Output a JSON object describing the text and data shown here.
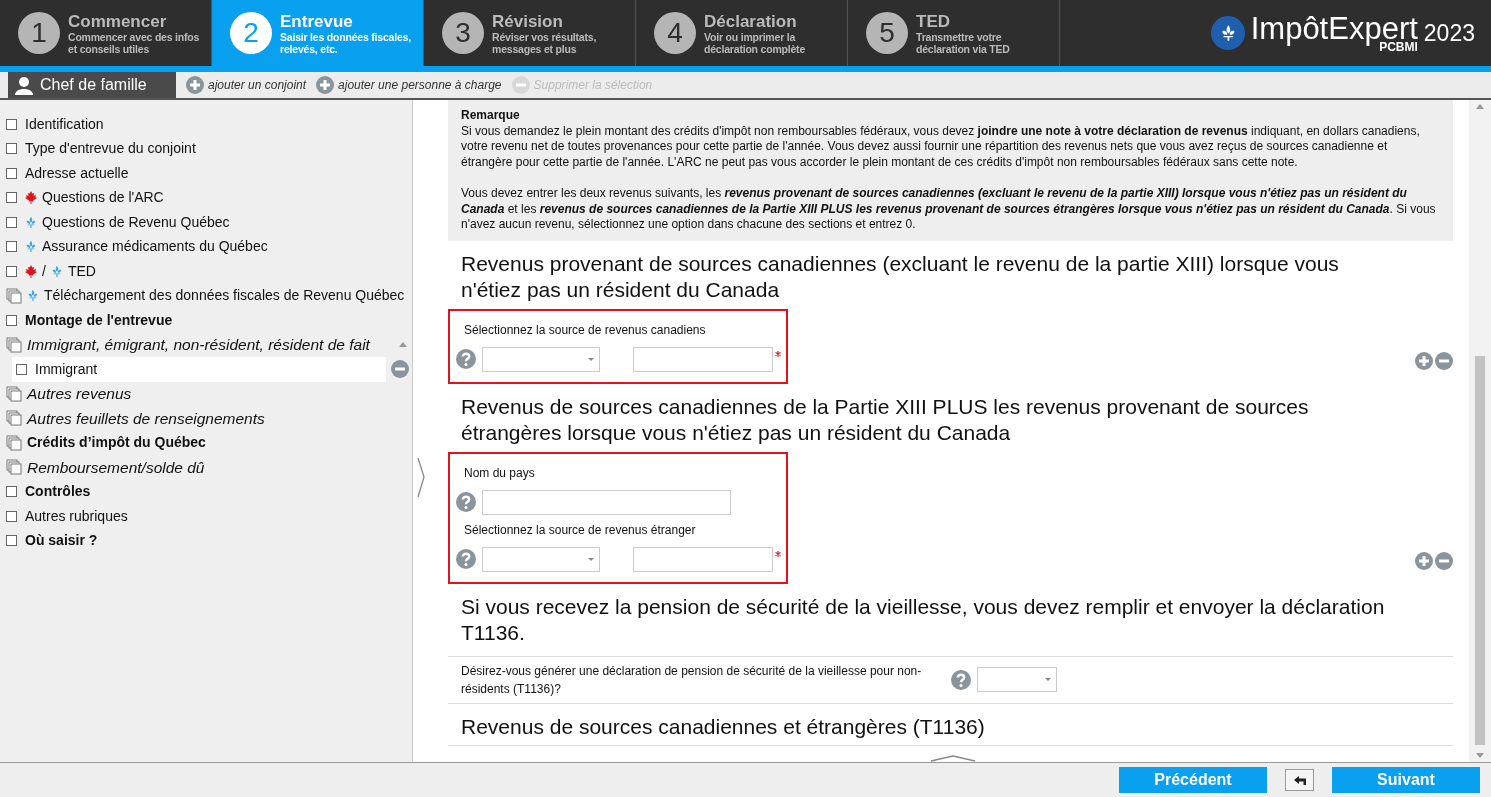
{
  "steps": [
    {
      "number": "1",
      "title": "Commencer",
      "subtitle": "Commencer avec des infos et conseils utiles",
      "selected": false
    },
    {
      "number": "2",
      "title": "Entrevue",
      "subtitle": "Saisir les données fiscales, relevés, etc.",
      "selected": true
    },
    {
      "number": "3",
      "title": "Révision",
      "subtitle": "Réviser vos résultats, messages et plus",
      "selected": false
    },
    {
      "number": "4",
      "title": "Déclaration",
      "subtitle": "Voir ou imprimer la déclaration complète",
      "selected": false
    },
    {
      "number": "5",
      "title": "TED",
      "subtitle": "Transmettre votre déclaration via TED",
      "selected": false
    }
  ],
  "logo": {
    "name": "ImpôtExpert",
    "sub": "PCBMI",
    "year": "2023"
  },
  "person_bar": {
    "tab": "Chef de famille",
    "actions": [
      {
        "label": "ajouter un conjoint",
        "disabled": false
      },
      {
        "label": "ajouter une personne à charge",
        "disabled": false
      },
      {
        "label": "Supprimer la sélection",
        "disabled": true
      }
    ]
  },
  "sidebar": {
    "items": [
      {
        "label": "Identification",
        "kind": "topic",
        "checked": false
      },
      {
        "label": "Type d'entrevue du conjoint",
        "kind": "topic",
        "checked": false
      },
      {
        "label": "Adresse actuelle",
        "kind": "topic",
        "checked": false
      },
      {
        "label": "Questions de l'ARC",
        "kind": "topic",
        "checked": false,
        "flags": [
          {
            "kind": "federal"
          }
        ]
      },
      {
        "label": "Questions de Revenu Québec",
        "kind": "topic",
        "checked": false,
        "flags": [
          {
            "kind": "provincial"
          }
        ]
      },
      {
        "label": "Assurance médicaments du Québec",
        "kind": "topic",
        "checked": false,
        "flags": [
          {
            "kind": "provincial"
          }
        ]
      },
      {
        "label": "TED",
        "kind": "topic",
        "checked": false,
        "flags": [
          {
            "kind": "federal"
          },
          {
            "kind": "provincial"
          }
        ],
        "flag_joiner": "/"
      },
      {
        "label": "Téléchargement des données fiscales de Revenu Québec",
        "kind": "multi_topic",
        "flags": [
          {
            "kind": "provincial"
          }
        ]
      },
      {
        "label": "Montage de l'entrevue",
        "kind": "heading",
        "checked": false
      },
      {
        "label": "Immigrant, émigrant, non-résident, résident de fait",
        "kind": "multi_group",
        "expanded": true,
        "children": [
          {
            "label": "Immigrant",
            "kind": "topic",
            "checked": false,
            "selected": true
          }
        ]
      },
      {
        "label": "Autres revenus",
        "kind": "multi_group"
      },
      {
        "label": "Autres feuillets de renseignements",
        "kind": "multi_group"
      },
      {
        "label": "Crédits d’impôt du Québec",
        "kind": "multi_heading"
      },
      {
        "label": "Remboursement/solde dû",
        "kind": "multi_group"
      },
      {
        "label": "Contrôles",
        "kind": "heading",
        "checked": false
      },
      {
        "label": "Autres rubriques",
        "kind": "topic",
        "checked": false
      },
      {
        "label": "Où saisir ?",
        "kind": "heading",
        "checked": false
      }
    ]
  },
  "note": {
    "title": "Remarque",
    "paragraphs": [
      "Si vous demandez le plein montant des crédits d'impôt non remboursables fédéraux, vous devez **joindre une note à votre déclaration de revenus** indiquant, en dollars canadiens, votre revenu net de toutes provenances pour cette partie de l'année. Vous devez aussi fournir une répartition des revenus nets que vous avez reçus de sources canadienne et étrangère pour cette partie de l'année. L'ARC ne peut pas vous accorder le plein montant de ces crédits d'impôt non remboursables fédéraux sans cette note.",
      "Vous devez entrer les deux revenus suivants, les *revenus provenant de sources canadiennes (excluant le revenu de la partie XIII) lorsque vous n'étiez pas un résident du Canada* et les *revenus de sources canadiennes de la Partie XIII PLUS les revenus provenant de sources étrangères lorsque vous n'étiez pas un résident du Canada*. Si vous n'avez aucun revenu, sélectionnez une option dans chacune des sections et entrez 0."
    ]
  },
  "content": [
    {
      "kind": "heading",
      "text": "Revenus provenant de sources canadiennes (excluant le revenu de la partie XIII) lorsque vous n'étiez pas un résident du Canada"
    },
    {
      "kind": "group",
      "highlighted": true,
      "fields": [
        {
          "kind": "select_amount",
          "label": "Sélectionnez la source de revenus canadiens",
          "required": true
        }
      ]
    },
    {
      "kind": "heading",
      "text": "Revenus de sources canadiennes de la Partie XIII PLUS les revenus provenant de sources étrangères lorsque vous n'étiez pas un résident du Canada"
    },
    {
      "kind": "group",
      "highlighted": true,
      "fields": [
        {
          "kind": "text",
          "label": "Nom du pays"
        },
        {
          "kind": "select_amount",
          "label": "Sélectionnez la source de revenus étranger",
          "required": true
        }
      ]
    },
    {
      "kind": "heading",
      "text": "Si vous recevez la pension de sécurité de la vieillesse, vous devez remplir et envoyer la déclaration T1136."
    },
    {
      "kind": "question",
      "label": "Désirez-vous générer une déclaration de pension de sécurité de la vieillesse pour non-résidents (T1136)?"
    },
    {
      "kind": "heading",
      "text": "Revenus de sources canadiennes et étrangères (T1136)"
    }
  ],
  "footer": {
    "buttons": [
      {
        "kind": "primary",
        "label": "Précédent"
      },
      {
        "kind": "back"
      },
      {
        "kind": "primary",
        "label": "Suivant"
      }
    ]
  }
}
